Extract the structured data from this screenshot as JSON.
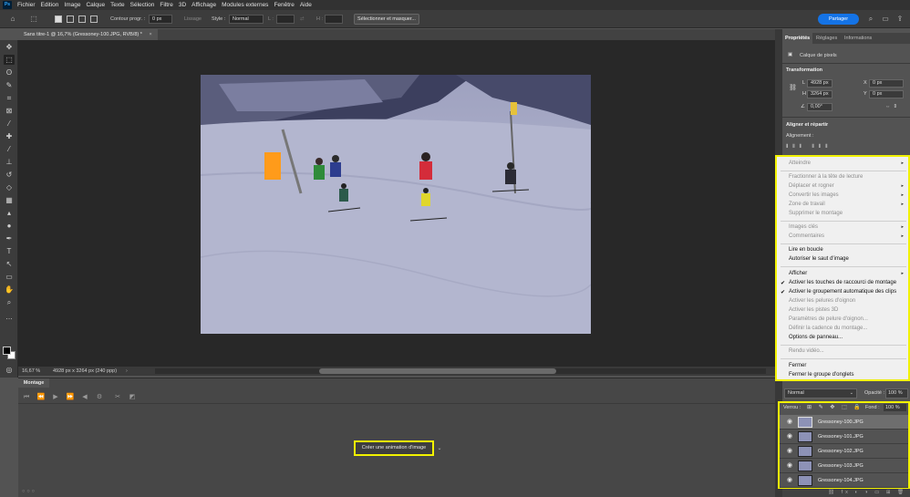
{
  "menubar": {
    "app_logo": "Ps",
    "items": [
      "Fichier",
      "Edition",
      "Image",
      "Calque",
      "Texte",
      "Sélection",
      "Filtre",
      "3D",
      "Affichage",
      "Modules externes",
      "Fenêtre",
      "Aide"
    ]
  },
  "options": {
    "feather_label": "Contour progr. :",
    "feather_value": "0 px",
    "antialias_label": "Lissage",
    "style_label": "Style :",
    "style_value": "Normal",
    "width_label": "L :",
    "height_label": "H :",
    "select_mask_button": "Sélectionner et masquer...",
    "share_button": "Partager"
  },
  "document": {
    "tab_title": "Sans titre-1 @ 16,7% (Gressoney-100.JPG, RVB/8) *",
    "zoom": "16,67 %",
    "size_info": "4928 px x 3264 px (240 ppp)"
  },
  "timeline": {
    "tab_label": "Montage",
    "create_animation_button": "Créer une animation d'image"
  },
  "properties": {
    "tabs": [
      "Propriétés",
      "Réglages",
      "Informations"
    ],
    "layer_kind": "Calque de pixels",
    "transform_title": "Transformation",
    "w_label": "L",
    "w_value": "4928 px",
    "h_label": "H",
    "h_value": "3264 px",
    "x_label": "X",
    "x_value": "0 px",
    "y_label": "Y",
    "y_value": "0 px",
    "angle_value": "0,00°",
    "align_title": "Aligner et répartir",
    "alignment_label": "Alignement :"
  },
  "context_menu": {
    "items": [
      {
        "label": "Atteindre",
        "enabled": false,
        "submenu": true,
        "checked": false
      },
      {
        "label": "Fractionner à la tête de lecture",
        "enabled": false,
        "submenu": false,
        "checked": false
      },
      {
        "label": "Déplacer et rogner",
        "enabled": false,
        "submenu": true,
        "checked": false
      },
      {
        "label": "Convertir les images",
        "enabled": false,
        "submenu": true,
        "checked": false
      },
      {
        "label": "Zone de travail",
        "enabled": false,
        "submenu": true,
        "checked": false
      },
      {
        "label": "Supprimer le montage",
        "enabled": false,
        "submenu": false,
        "checked": false
      },
      {
        "label": "Images clés",
        "enabled": false,
        "submenu": true,
        "checked": false
      },
      {
        "label": "Commentaires",
        "enabled": false,
        "submenu": true,
        "checked": false
      },
      {
        "label": "Lire en boucle",
        "enabled": true,
        "submenu": false,
        "checked": false
      },
      {
        "label": "Autoriser le saut d'image",
        "enabled": true,
        "submenu": false,
        "checked": false
      },
      {
        "label": "Afficher",
        "enabled": true,
        "submenu": true,
        "checked": false
      },
      {
        "label": "Activer les touches de raccourci de montage",
        "enabled": true,
        "submenu": false,
        "checked": true
      },
      {
        "label": "Activer le groupement automatique des clips",
        "enabled": true,
        "submenu": false,
        "checked": true
      },
      {
        "label": "Activer les pelures d'oignon",
        "enabled": false,
        "submenu": false,
        "checked": false
      },
      {
        "label": "Activer les pistes 3D",
        "enabled": false,
        "submenu": false,
        "checked": false
      },
      {
        "label": "Paramètres de pelure d'oignon...",
        "enabled": false,
        "submenu": false,
        "checked": false
      },
      {
        "label": "Définir la cadence du montage...",
        "enabled": false,
        "submenu": false,
        "checked": false
      },
      {
        "label": "Options de panneau...",
        "enabled": true,
        "submenu": false,
        "checked": false
      },
      {
        "label": "Rendu vidéo...",
        "enabled": false,
        "submenu": false,
        "checked": false
      },
      {
        "label": "Fermer",
        "enabled": true,
        "submenu": false,
        "checked": false
      },
      {
        "label": "Fermer le groupe d'onglets",
        "enabled": true,
        "submenu": false,
        "checked": false
      }
    ]
  },
  "layers": {
    "blend_mode": "Normal",
    "opacity_label": "Opacité :",
    "opacity_value": "100 %",
    "lock_label": "Verrou :",
    "fill_label": "Fond :",
    "fill_value": "100 %",
    "items": [
      {
        "name": "Gressoney-100.JPG",
        "selected": true
      },
      {
        "name": "Gressoney-101.JPG",
        "selected": false
      },
      {
        "name": "Gressoney-102.JPG",
        "selected": false
      },
      {
        "name": "Gressoney-103.JPG",
        "selected": false
      },
      {
        "name": "Gressoney-104.JPG",
        "selected": false
      }
    ]
  },
  "colors": {
    "highlight": "#f2f200",
    "share_blue": "#1473e6",
    "snow": "#b6b9d1"
  }
}
